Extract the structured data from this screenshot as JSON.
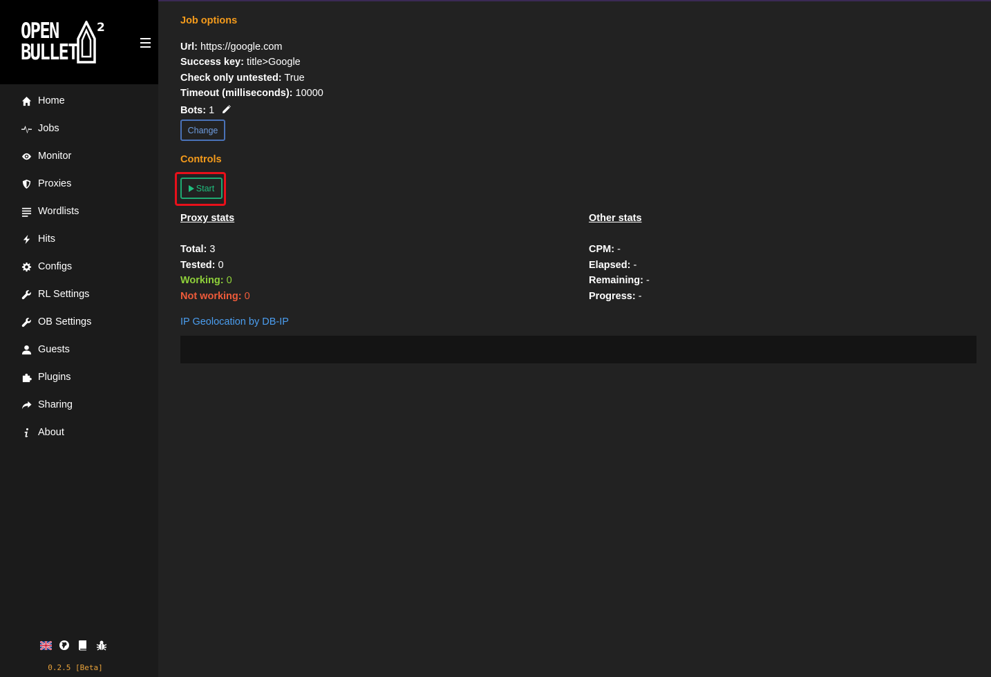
{
  "app": {
    "logo_line1": "OPEN",
    "logo_line2": "BULLET",
    "logo_superscript": "2",
    "version": "0.2.5 [Beta]"
  },
  "sidebar": {
    "items": [
      {
        "label": "Home",
        "icon": "home-icon"
      },
      {
        "label": "Jobs",
        "icon": "pulse-icon"
      },
      {
        "label": "Monitor",
        "icon": "eye-icon"
      },
      {
        "label": "Proxies",
        "icon": "shield-icon"
      },
      {
        "label": "Wordlists",
        "icon": "list-icon"
      },
      {
        "label": "Hits",
        "icon": "bolt-icon"
      },
      {
        "label": "Configs",
        "icon": "gear-icon"
      },
      {
        "label": "RL Settings",
        "icon": "wrench-icon"
      },
      {
        "label": "OB Settings",
        "icon": "wrench-icon"
      },
      {
        "label": "Guests",
        "icon": "user-icon"
      },
      {
        "label": "Plugins",
        "icon": "puzzle-icon"
      },
      {
        "label": "Sharing",
        "icon": "share-icon"
      },
      {
        "label": "About",
        "icon": "info-icon"
      }
    ],
    "footer_icons": [
      "uk-flag-icon",
      "globe-icon",
      "book-icon",
      "bug-icon"
    ]
  },
  "job_options": {
    "title": "Job options",
    "url_label": "Url:",
    "url_value": "https://google.com",
    "success_key_label": "Success key:",
    "success_key_value": "title>Google",
    "check_untested_label": "Check only untested:",
    "check_untested_value": "True",
    "timeout_label": "Timeout (milliseconds):",
    "timeout_value": "10000",
    "bots_label": "Bots:",
    "bots_value": "1",
    "change_label": "Change"
  },
  "controls": {
    "title": "Controls",
    "start_label": "Start"
  },
  "proxy_stats": {
    "title": "Proxy stats",
    "total_label": "Total:",
    "total_value": "3",
    "tested_label": "Tested:",
    "tested_value": "0",
    "working_label": "Working:",
    "working_value": "0",
    "not_working_label": "Not working:",
    "not_working_value": "0"
  },
  "other_stats": {
    "title": "Other stats",
    "cpm_label": "CPM:",
    "cpm_value": "-",
    "elapsed_label": "Elapsed:",
    "elapsed_value": "-",
    "remaining_label": "Remaining:",
    "remaining_value": "-",
    "progress_label": "Progress:",
    "progress_value": "-"
  },
  "geo": {
    "link_text": "IP Geolocation by DB-IP"
  },
  "colors": {
    "accent_orange": "#f59b1b",
    "link_blue": "#4b9ef0",
    "success_green": "#1fbf7e",
    "working_green": "#8fd13a",
    "error_red": "#ef5b3a",
    "highlight_red": "#e8101a"
  }
}
